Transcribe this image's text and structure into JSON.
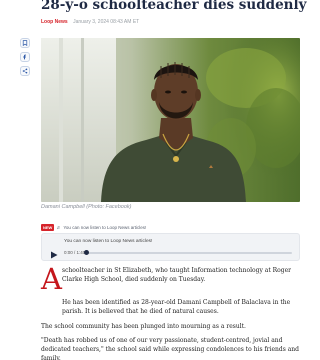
{
  "article": {
    "headline": "28-y-o schoolteacher dies suddenly",
    "source": "Loop News",
    "date": "January 3, 2024 08:43 AM ET",
    "photo_caption": "Damani Campbell (Photo: Facebook)",
    "dropcap": "A",
    "paragraphs": [
      "schoolteacher in St Elizabeth, who taught Information technology at Roger Clarke High School, died suddenly on Tuesday.",
      "He has been identified as 28-year-old Damani Campbell of Balaclava in the parish. It is believed that he died of natural causes.",
      "The school community has been plunged into mourning as a result.",
      "\"Death has robbed us of one of our very passionate, student-centred, jovial and dedicated teachers,\" the school said while expressing condolences to his friends and family."
    ]
  },
  "share_bar": {
    "icons": [
      "bookmark-icon",
      "facebook-icon",
      "share-icon"
    ]
  },
  "audio": {
    "badge": "NEW",
    "promo": "You can now listen to Loop News articles!",
    "player_title": "You can now listen to Loop News articles!",
    "time": "0:00 / 1:40",
    "progress": 0.0
  },
  "colors": {
    "headline": "#1f2a44",
    "accent": "#d6232a",
    "dropcap": "#c4161c"
  }
}
